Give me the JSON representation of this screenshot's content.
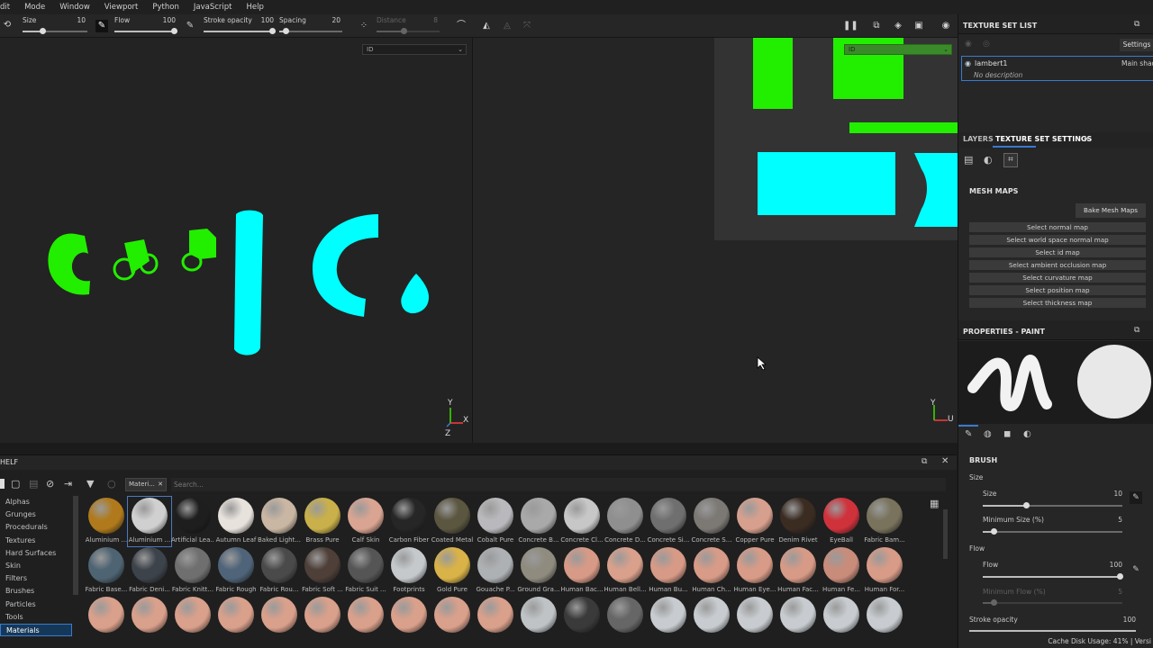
{
  "menu": [
    "dit",
    "Mode",
    "Window",
    "Viewport",
    "Python",
    "JavaScript",
    "Help"
  ],
  "toolbar": {
    "size_label": "Size",
    "size_value": "10",
    "flow_label": "Flow",
    "flow_value": "100",
    "stroke_opacity_label": "Stroke opacity",
    "stroke_opacity_value": "100",
    "spacing_label": "Spacing",
    "spacing_value": "20",
    "distance_label": "Distance",
    "distance_value": "8"
  },
  "viewport": {
    "left_mode": "ID",
    "right_mode": "ID",
    "left_axis": {
      "y": "Y",
      "x": "X",
      "z": "Z"
    },
    "right_axis": {
      "y": "Y",
      "u": "U"
    }
  },
  "shelf": {
    "title": "HELF",
    "filter_tag": "Materi...",
    "search_placeholder": "Search...",
    "categories": [
      "Alphas",
      "Grunges",
      "Procedurals",
      "Textures",
      "Hard Surfaces",
      "Skin",
      "Filters",
      "Brushes",
      "Particles",
      "Tools",
      "Materials"
    ],
    "active_category": "Materials",
    "row1": [
      {
        "name": "Aluminium ...",
        "color": "#b07a1c"
      },
      {
        "name": "Aluminium ...",
        "color": "#d0d0d0"
      },
      {
        "name": "Artificial Lea...",
        "color": "#1e1e1e"
      },
      {
        "name": "Autumn Leaf",
        "color": "#e8e2dc"
      },
      {
        "name": "Baked Light...",
        "color": "#c9b6a3"
      },
      {
        "name": "Brass Pure",
        "color": "#c9b04a"
      },
      {
        "name": "Calf Skin",
        "color": "#d9a492"
      },
      {
        "name": "Carbon Fiber",
        "color": "#262626"
      },
      {
        "name": "Coated Metal",
        "color": "#5b5640"
      },
      {
        "name": "Cobalt Pure",
        "color": "#b9b9bd"
      },
      {
        "name": "Concrete B...",
        "color": "#a9a9a9"
      },
      {
        "name": "Concrete Cl...",
        "color": "#c7c7c7"
      },
      {
        "name": "Concrete D...",
        "color": "#8f8f8f"
      },
      {
        "name": "Concrete Si...",
        "color": "#6f6f6f"
      },
      {
        "name": "Concrete S...",
        "color": "#7c7974"
      },
      {
        "name": "Copper Pure",
        "color": "#d7a08e"
      },
      {
        "name": "Denim Rivet",
        "color": "#3b2c22"
      },
      {
        "name": "EyeBall",
        "color": "#d0323c"
      },
      {
        "name": "Fabric Bam...",
        "color": "#79735d"
      }
    ],
    "row2": [
      {
        "name": "Fabric Base...",
        "color": "#4e6473"
      },
      {
        "name": "Fabric Deni...",
        "color": "#3d434b"
      },
      {
        "name": "Fabric Knitt...",
        "color": "#6f6f6f"
      },
      {
        "name": "Fabric Rough",
        "color": "#4f6479"
      },
      {
        "name": "Fabric Rou...",
        "color": "#4a4a4a"
      },
      {
        "name": "Fabric Soft ...",
        "color": "#4e3f38"
      },
      {
        "name": "Fabric Suit ...",
        "color": "#555555"
      },
      {
        "name": "Footprints",
        "color": "#c5c9cc"
      },
      {
        "name": "Gold Pure",
        "color": "#d9b248"
      },
      {
        "name": "Gouache P...",
        "color": "#aeb1b4"
      },
      {
        "name": "Ground Gra...",
        "color": "#8f8b7f"
      },
      {
        "name": "Human Bac...",
        "color": "#d79a86"
      },
      {
        "name": "Human Bell...",
        "color": "#d9a08b"
      },
      {
        "name": "Human Bu...",
        "color": "#d79a86"
      },
      {
        "name": "Human Ch...",
        "color": "#d89b87"
      },
      {
        "name": "Human Eye...",
        "color": "#d89b87"
      },
      {
        "name": "Human Fac...",
        "color": "#d79a86"
      },
      {
        "name": "Human Fe...",
        "color": "#c98c7a"
      },
      {
        "name": "Human For...",
        "color": "#d89b87"
      }
    ],
    "row3_colors": [
      "#d9a08b",
      "#d9a08b",
      "#d9a08b",
      "#d9a08b",
      "#d9a08b",
      "#d9a08b",
      "#d9a08b",
      "#d9a08b",
      "#d9a08b",
      "#d9a08b",
      "#bfc3c6",
      "#3a3a3a",
      "#666666",
      "#c8ccd0",
      "#c8ccd0",
      "#c8ccd0",
      "#c8ccd0",
      "#c8ccd0",
      "#c8ccd0"
    ]
  },
  "right_panel": {
    "texture_set_list_title": "TEXTURE SET LIST",
    "settings_label": "Settings",
    "texture_set_name": "lambert1",
    "shader_name": "Main shad",
    "description": "No description",
    "tab_layers": "LAYERS",
    "tab_texture_set_settings": "TEXTURE SET SETTINGS",
    "mesh_maps_title": "MESH MAPS",
    "bake_button": "Bake Mesh Maps",
    "mesh_map_buttons": [
      "Select normal map",
      "Select world space normal map",
      "Select id map",
      "Select ambient occlusion map",
      "Select curvature map",
      "Select position map",
      "Select thickness map"
    ],
    "properties_title": "PROPERTIES - PAINT",
    "brush_title": "BRUSH",
    "size_section": "Size",
    "size_label": "Size",
    "size_value": "10",
    "min_size_label": "Minimum Size (%)",
    "min_size_value": "5",
    "flow_section": "Flow",
    "flow_label": "Flow",
    "flow_value": "100",
    "min_flow_label": "Minimum Flow (%)",
    "min_flow_value": "5",
    "stroke_opacity_label": "Stroke opacity",
    "stroke_opacity_value": "100"
  },
  "status": {
    "text": "Cache Disk Usage:   41% | Versi"
  },
  "colors": {
    "accent": "#3a7ad0",
    "id_green": "#22ee00",
    "id_cyan": "#00ffff"
  }
}
